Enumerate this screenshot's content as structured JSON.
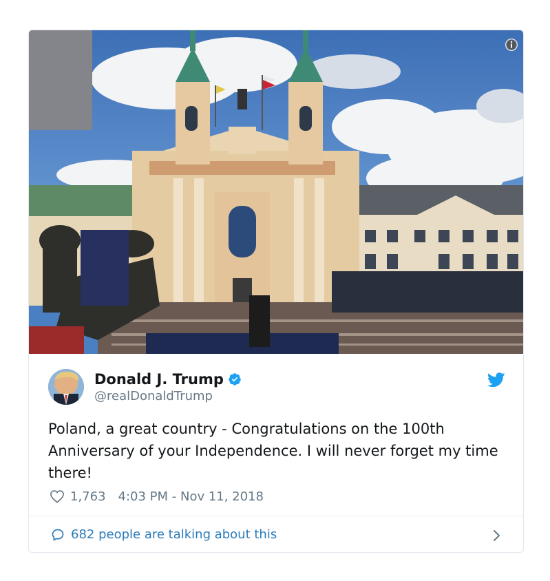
{
  "tweet": {
    "photo_alt_icon": "info-icon",
    "author": {
      "display_name": "Donald J. Trump",
      "handle": "@realDonaldTrump",
      "verified": true,
      "verified_icon": "verified-badge-icon",
      "avatar_icon": "avatar"
    },
    "platform_icon": "twitter-bird-icon",
    "text": "Poland, a great country - Congratulations on the 100th Anniversary of your Independence. I will never forget my time there!",
    "likes": "1,763",
    "like_icon": "heart-icon",
    "timestamp": "4:03 PM - Nov 11, 2018",
    "conversation": {
      "label": "682 people are talking about this",
      "icon": "speech-bubble-icon",
      "chevron_icon": "chevron-right-icon"
    }
  },
  "colors": {
    "text_primary": "#14171a",
    "text_secondary": "#657786",
    "link": "#2b7bb9",
    "verified": "#1da1f2",
    "twitter_blue": "#1da1f2",
    "border": "#e1e8ed"
  }
}
